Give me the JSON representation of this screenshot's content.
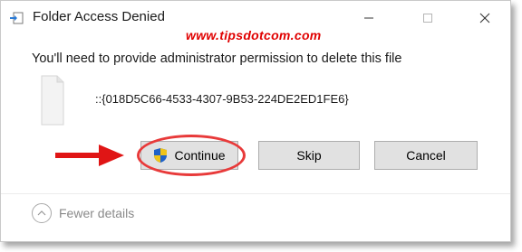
{
  "window": {
    "title": "Folder Access Denied",
    "icon": "file-move-icon"
  },
  "watermark": "www.tipsdotcom.com",
  "message": "You'll need to provide administrator permission to delete this file",
  "file": {
    "icon": "blank-file-icon",
    "name": "::{018D5C66-4533-4307-9B53-224DE2ED1FE6}"
  },
  "buttons": {
    "continue": "Continue",
    "skip": "Skip",
    "cancel": "Cancel"
  },
  "details_toggle": "Fewer details",
  "colors": {
    "accent_red": "#e83a3a",
    "watermark_red": "#e00000",
    "button_bg": "#e1e1e1"
  }
}
